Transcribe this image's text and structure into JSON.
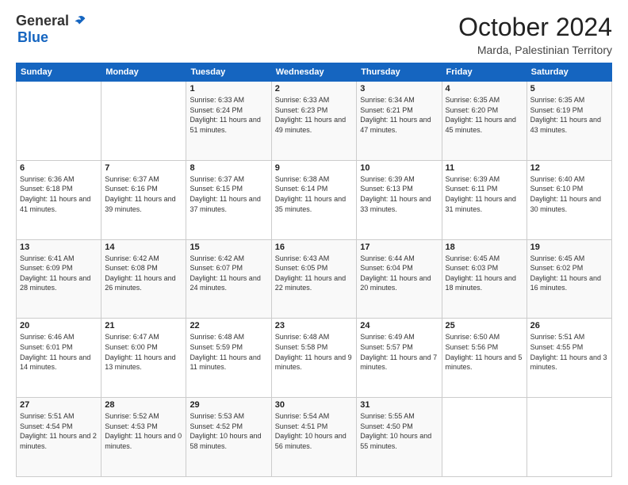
{
  "logo": {
    "general": "General",
    "blue": "Blue"
  },
  "header": {
    "month": "October 2024",
    "location": "Marda, Palestinian Territory"
  },
  "days_of_week": [
    "Sunday",
    "Monday",
    "Tuesday",
    "Wednesday",
    "Thursday",
    "Friday",
    "Saturday"
  ],
  "weeks": [
    [
      {
        "day": "",
        "info": ""
      },
      {
        "day": "",
        "info": ""
      },
      {
        "day": "1",
        "info": "Sunrise: 6:33 AM\nSunset: 6:24 PM\nDaylight: 11 hours and 51 minutes."
      },
      {
        "day": "2",
        "info": "Sunrise: 6:33 AM\nSunset: 6:23 PM\nDaylight: 11 hours and 49 minutes."
      },
      {
        "day": "3",
        "info": "Sunrise: 6:34 AM\nSunset: 6:21 PM\nDaylight: 11 hours and 47 minutes."
      },
      {
        "day": "4",
        "info": "Sunrise: 6:35 AM\nSunset: 6:20 PM\nDaylight: 11 hours and 45 minutes."
      },
      {
        "day": "5",
        "info": "Sunrise: 6:35 AM\nSunset: 6:19 PM\nDaylight: 11 hours and 43 minutes."
      }
    ],
    [
      {
        "day": "6",
        "info": "Sunrise: 6:36 AM\nSunset: 6:18 PM\nDaylight: 11 hours and 41 minutes."
      },
      {
        "day": "7",
        "info": "Sunrise: 6:37 AM\nSunset: 6:16 PM\nDaylight: 11 hours and 39 minutes."
      },
      {
        "day": "8",
        "info": "Sunrise: 6:37 AM\nSunset: 6:15 PM\nDaylight: 11 hours and 37 minutes."
      },
      {
        "day": "9",
        "info": "Sunrise: 6:38 AM\nSunset: 6:14 PM\nDaylight: 11 hours and 35 minutes."
      },
      {
        "day": "10",
        "info": "Sunrise: 6:39 AM\nSunset: 6:13 PM\nDaylight: 11 hours and 33 minutes."
      },
      {
        "day": "11",
        "info": "Sunrise: 6:39 AM\nSunset: 6:11 PM\nDaylight: 11 hours and 31 minutes."
      },
      {
        "day": "12",
        "info": "Sunrise: 6:40 AM\nSunset: 6:10 PM\nDaylight: 11 hours and 30 minutes."
      }
    ],
    [
      {
        "day": "13",
        "info": "Sunrise: 6:41 AM\nSunset: 6:09 PM\nDaylight: 11 hours and 28 minutes."
      },
      {
        "day": "14",
        "info": "Sunrise: 6:42 AM\nSunset: 6:08 PM\nDaylight: 11 hours and 26 minutes."
      },
      {
        "day": "15",
        "info": "Sunrise: 6:42 AM\nSunset: 6:07 PM\nDaylight: 11 hours and 24 minutes."
      },
      {
        "day": "16",
        "info": "Sunrise: 6:43 AM\nSunset: 6:05 PM\nDaylight: 11 hours and 22 minutes."
      },
      {
        "day": "17",
        "info": "Sunrise: 6:44 AM\nSunset: 6:04 PM\nDaylight: 11 hours and 20 minutes."
      },
      {
        "day": "18",
        "info": "Sunrise: 6:45 AM\nSunset: 6:03 PM\nDaylight: 11 hours and 18 minutes."
      },
      {
        "day": "19",
        "info": "Sunrise: 6:45 AM\nSunset: 6:02 PM\nDaylight: 11 hours and 16 minutes."
      }
    ],
    [
      {
        "day": "20",
        "info": "Sunrise: 6:46 AM\nSunset: 6:01 PM\nDaylight: 11 hours and 14 minutes."
      },
      {
        "day": "21",
        "info": "Sunrise: 6:47 AM\nSunset: 6:00 PM\nDaylight: 11 hours and 13 minutes."
      },
      {
        "day": "22",
        "info": "Sunrise: 6:48 AM\nSunset: 5:59 PM\nDaylight: 11 hours and 11 minutes."
      },
      {
        "day": "23",
        "info": "Sunrise: 6:48 AM\nSunset: 5:58 PM\nDaylight: 11 hours and 9 minutes."
      },
      {
        "day": "24",
        "info": "Sunrise: 6:49 AM\nSunset: 5:57 PM\nDaylight: 11 hours and 7 minutes."
      },
      {
        "day": "25",
        "info": "Sunrise: 6:50 AM\nSunset: 5:56 PM\nDaylight: 11 hours and 5 minutes."
      },
      {
        "day": "26",
        "info": "Sunrise: 5:51 AM\nSunset: 4:55 PM\nDaylight: 11 hours and 3 minutes."
      }
    ],
    [
      {
        "day": "27",
        "info": "Sunrise: 5:51 AM\nSunset: 4:54 PM\nDaylight: 11 hours and 2 minutes."
      },
      {
        "day": "28",
        "info": "Sunrise: 5:52 AM\nSunset: 4:53 PM\nDaylight: 11 hours and 0 minutes."
      },
      {
        "day": "29",
        "info": "Sunrise: 5:53 AM\nSunset: 4:52 PM\nDaylight: 10 hours and 58 minutes."
      },
      {
        "day": "30",
        "info": "Sunrise: 5:54 AM\nSunset: 4:51 PM\nDaylight: 10 hours and 56 minutes."
      },
      {
        "day": "31",
        "info": "Sunrise: 5:55 AM\nSunset: 4:50 PM\nDaylight: 10 hours and 55 minutes."
      },
      {
        "day": "",
        "info": ""
      },
      {
        "day": "",
        "info": ""
      }
    ]
  ]
}
